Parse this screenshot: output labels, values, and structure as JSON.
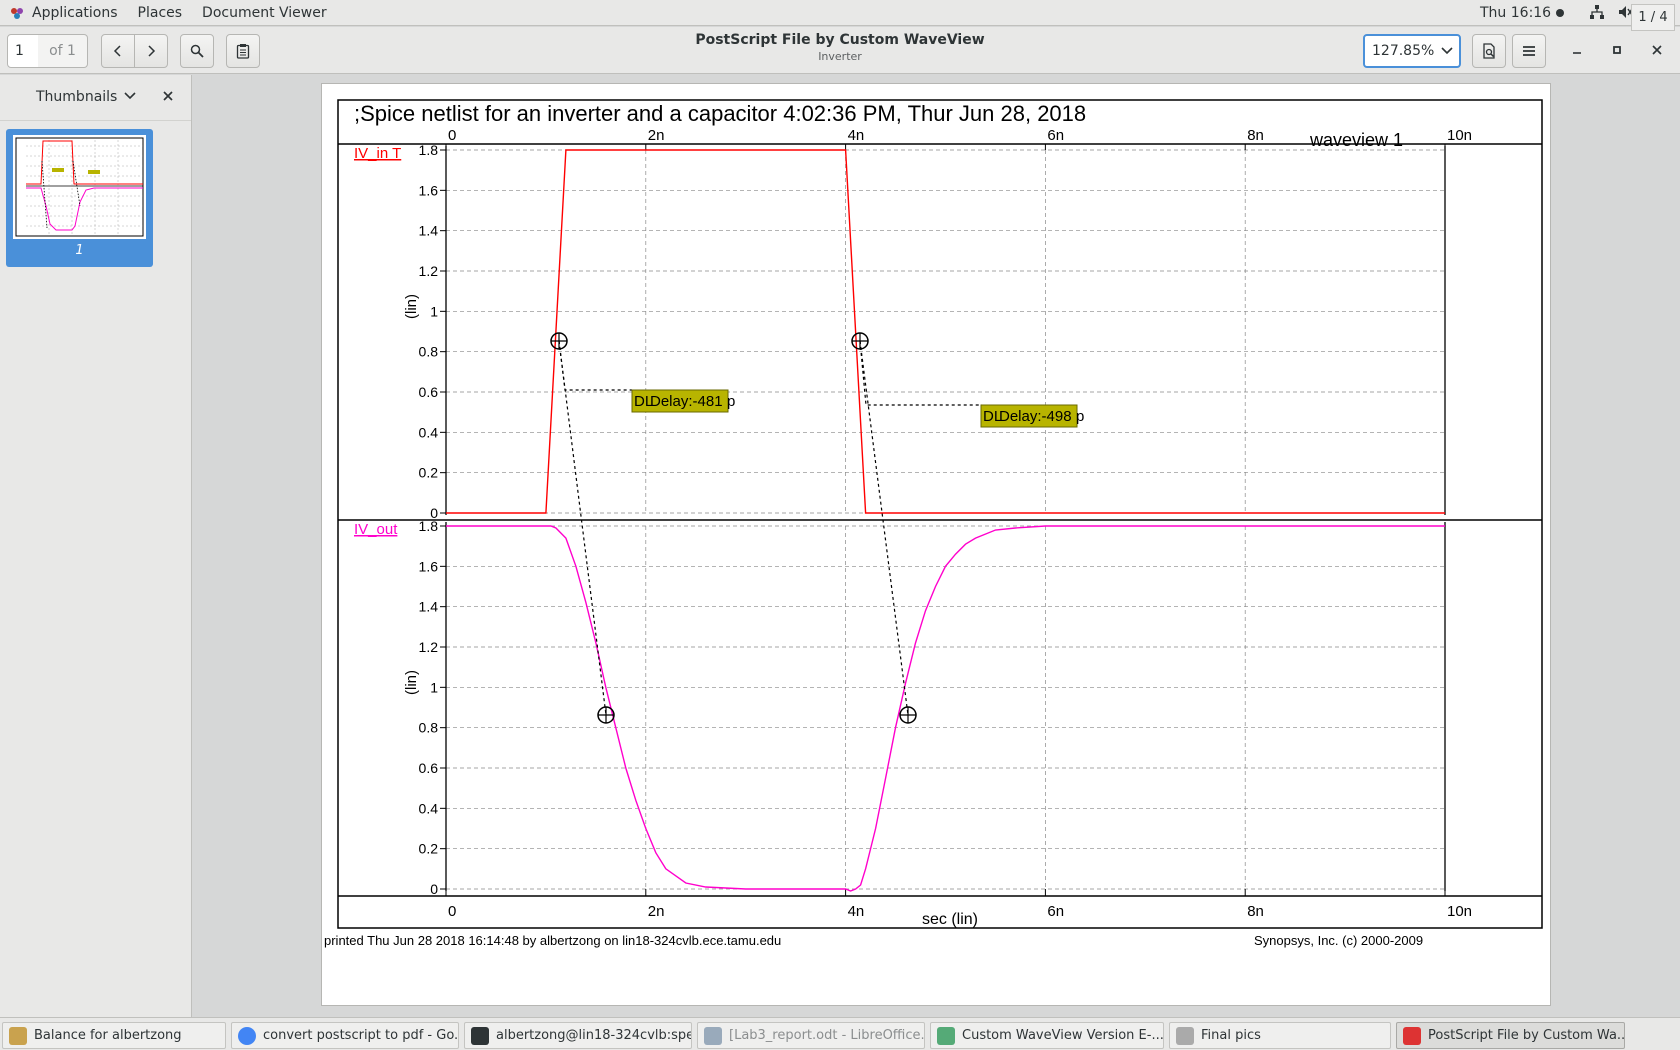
{
  "topbar": {
    "applications": "Applications",
    "places": "Places",
    "document_viewer": "Document Viewer",
    "clock": "Thu 16:16",
    "tray_icons": [
      "network-icon",
      "volume-icon",
      "power-icon"
    ]
  },
  "toolbar": {
    "page_number": "1",
    "page_of": "of 1",
    "title": "PostScript File by Custom WaveView",
    "subtitle": "Inverter",
    "zoom": "127.85%"
  },
  "sidebar": {
    "title": "Thumbnails",
    "thumb_label": "1"
  },
  "document": {
    "title": ";Spice netlist for an inverter and a capacitor 4:02:36 PM, Thur Jun 28, 2018",
    "view_label": "waveview 1",
    "footer_left": "printed Thu Jun 28 2018 16:14:48 by albertzong on lin18-324cvlb.ece.tamu.edu",
    "footer_right": "Synopsys, Inc. (c) 2000-2009",
    "xlabel": "sec (lin)",
    "ylabel": "(lin)",
    "x_ticks": [
      "0",
      "2n",
      "4n",
      "6n",
      "8n",
      "10n"
    ],
    "y_ticks": [
      "0",
      "0.2",
      "0.4",
      "0.6",
      "0.8",
      "1",
      "1.2",
      "1.4",
      "1.6",
      "1.8"
    ],
    "delay1": "Delay:-481",
    "delay1_unit": "p",
    "delay2": "Delay:-498",
    "delay2_unit": "p",
    "dl_prefix": "DL"
  },
  "chart_data": [
    {
      "type": "line",
      "name": "IV_in T",
      "color": "#ff0000",
      "xunit": "ns",
      "xlim": [
        0,
        10
      ],
      "ylim": [
        0,
        1.8
      ],
      "x": [
        0,
        1.0,
        1.2,
        4.0,
        4.2,
        10
      ],
      "y": [
        0,
        0,
        1.8,
        1.8,
        0,
        0
      ]
    },
    {
      "type": "line",
      "name": "IV_out",
      "color": "#ff00cc",
      "xunit": "ns",
      "xlim": [
        0,
        10
      ],
      "ylim": [
        0,
        1.8
      ],
      "x": [
        0,
        1.0,
        1.05,
        1.1,
        1.2,
        1.3,
        1.4,
        1.5,
        1.6,
        1.7,
        1.8,
        1.9,
        2.0,
        2.1,
        2.2,
        2.4,
        2.6,
        3.0,
        3.5,
        4.0,
        4.05,
        4.1,
        4.15,
        4.2,
        4.3,
        4.4,
        4.5,
        4.6,
        4.7,
        4.8,
        4.9,
        5.0,
        5.1,
        5.2,
        5.3,
        5.5,
        5.7,
        6.0,
        6.5,
        10
      ],
      "y": [
        1.8,
        1.8,
        1.8,
        1.79,
        1.74,
        1.6,
        1.42,
        1.22,
        1.0,
        0.8,
        0.6,
        0.44,
        0.3,
        0.18,
        0.1,
        0.03,
        0.01,
        0.0,
        0.0,
        0.0,
        -0.01,
        0.0,
        0.02,
        0.1,
        0.3,
        0.55,
        0.8,
        1.02,
        1.22,
        1.38,
        1.5,
        1.6,
        1.66,
        1.71,
        1.74,
        1.78,
        1.79,
        1.8,
        1.8,
        1.8
      ]
    }
  ],
  "taskbar": [
    {
      "label": "Balance for albertzong",
      "icon": "users-icon"
    },
    {
      "label": "convert postscript to pdf - Go...",
      "icon": "chrome-icon"
    },
    {
      "label": "albertzong@lin18-324cvlb:spe...",
      "icon": "terminal-icon"
    },
    {
      "label": "[Lab3_report.odt - LibreOffice...",
      "icon": "document-icon"
    },
    {
      "label": "Custom WaveView Version E-...",
      "icon": "waveview-icon"
    },
    {
      "label": "Final pics",
      "icon": "folder-icon"
    },
    {
      "label": "PostScript File by Custom Wa...",
      "icon": "pdf-icon"
    }
  ],
  "workspace": "1 / 4"
}
